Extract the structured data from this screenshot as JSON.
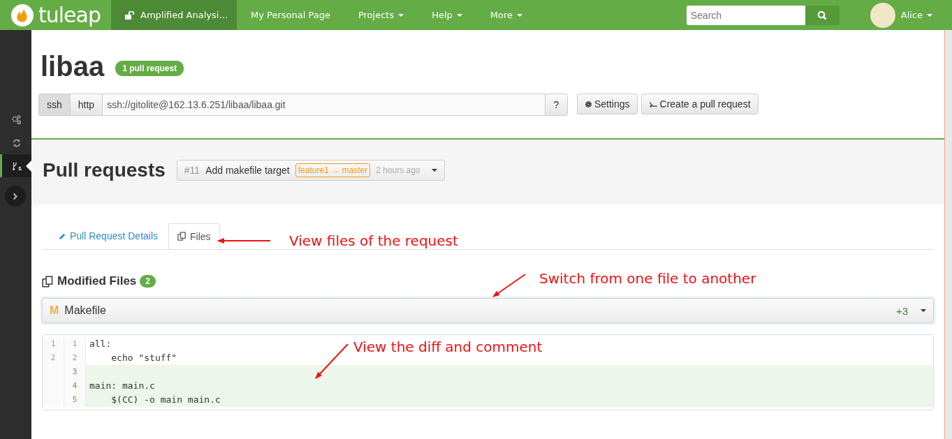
{
  "nav": {
    "logo": "tuleap",
    "project": "Amplified Analysi…",
    "links": [
      {
        "label": "My Personal Page",
        "dropdown": false
      },
      {
        "label": "Projects",
        "dropdown": true
      },
      {
        "label": "Help",
        "dropdown": true
      },
      {
        "label": "More",
        "dropdown": true
      }
    ],
    "search": {
      "placeholder": "Search"
    },
    "user": "Alice"
  },
  "sidebar": {
    "items": [
      {
        "kind": "gears",
        "selected": false
      },
      {
        "kind": "sync",
        "selected": false
      },
      {
        "kind": "git",
        "selected": true
      }
    ]
  },
  "repo": {
    "name": "libaa",
    "badge": "1 pull request",
    "protocols": [
      {
        "label": "ssh",
        "selected": true
      },
      {
        "label": "http",
        "selected": false
      }
    ],
    "clone_url": "ssh://gitolite@162.13.6.251/libaa/libaa.git",
    "help": "?",
    "buttons": [
      {
        "kind": "settings",
        "label": "Settings"
      },
      {
        "kind": "pull",
        "label": "Create a pull request"
      }
    ]
  },
  "pull_requests": {
    "title": "Pull requests",
    "current": {
      "number": "#11",
      "title": "Add makefile target",
      "branches": "feature1 → master",
      "age": "2 hours ago"
    }
  },
  "tabs": [
    {
      "label": "Pull Request Details",
      "kind": "pencil",
      "selected": false
    },
    {
      "label": "Files",
      "kind": "files",
      "selected": true
    }
  ],
  "files": {
    "title": "Modified Files",
    "count": "2",
    "current": {
      "status": "M",
      "name": "Makefile",
      "additions": "+3"
    }
  },
  "diff": {
    "lines": [
      {
        "old": "1",
        "new": "1",
        "code": "all:",
        "added": false
      },
      {
        "old": "2",
        "new": "2",
        "code": "    echo \"stuff\"",
        "added": false
      },
      {
        "new": "3",
        "added": true
      },
      {
        "new": "4",
        "code": "main: main.c",
        "added": true
      },
      {
        "new": "5",
        "code": "    $(CC) -o main main.c",
        "added": true
      }
    ]
  },
  "annotations": [
    {
      "text": "View files of the request"
    },
    {
      "text": "Switch from one file to another"
    },
    {
      "text": "View the diff and comment"
    }
  ]
}
